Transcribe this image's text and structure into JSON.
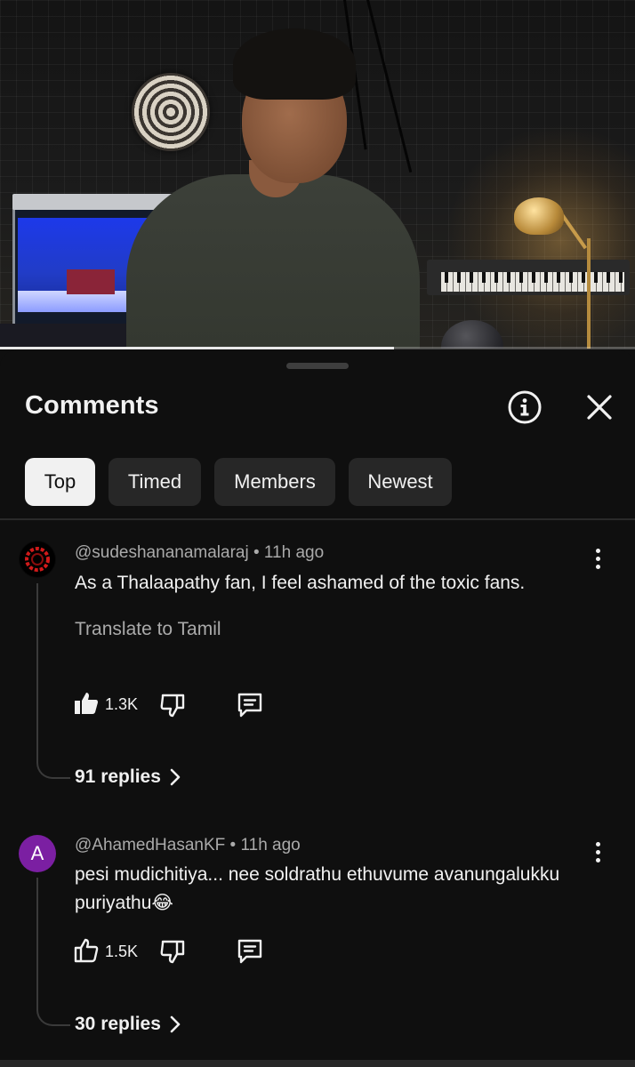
{
  "video": {
    "progress_percent": 62
  },
  "panel": {
    "title": "Comments",
    "info_icon": "info-circle-icon",
    "close_icon": "close-icon"
  },
  "filters": [
    {
      "label": "Top",
      "active": true
    },
    {
      "label": "Timed",
      "active": false
    },
    {
      "label": "Members",
      "active": false
    },
    {
      "label": "Newest",
      "active": false
    }
  ],
  "comments": [
    {
      "author": "@sudeshananamalaraj",
      "time": "11h ago",
      "meta": "@sudeshananamalaraj • 11h ago",
      "text": "As a Thalaapathy fan, I feel ashamed of the toxic fans.",
      "translate": "Translate to Tamil",
      "likes": "1.3K",
      "liked": true,
      "replies": "91 replies",
      "avatar_color": "#d11a1a"
    },
    {
      "author": "@AhamedHasanKF",
      "time": "11h ago",
      "meta": "@AhamedHasanKF • 11h ago",
      "text": "pesi mudichitiya... nee soldrathu ethuvume avanungalukku puriyathu😂",
      "likes": "1.5K",
      "liked": false,
      "replies": "30 replies",
      "avatar_letter": "A",
      "avatar_color": "#7b1fa2"
    }
  ]
}
